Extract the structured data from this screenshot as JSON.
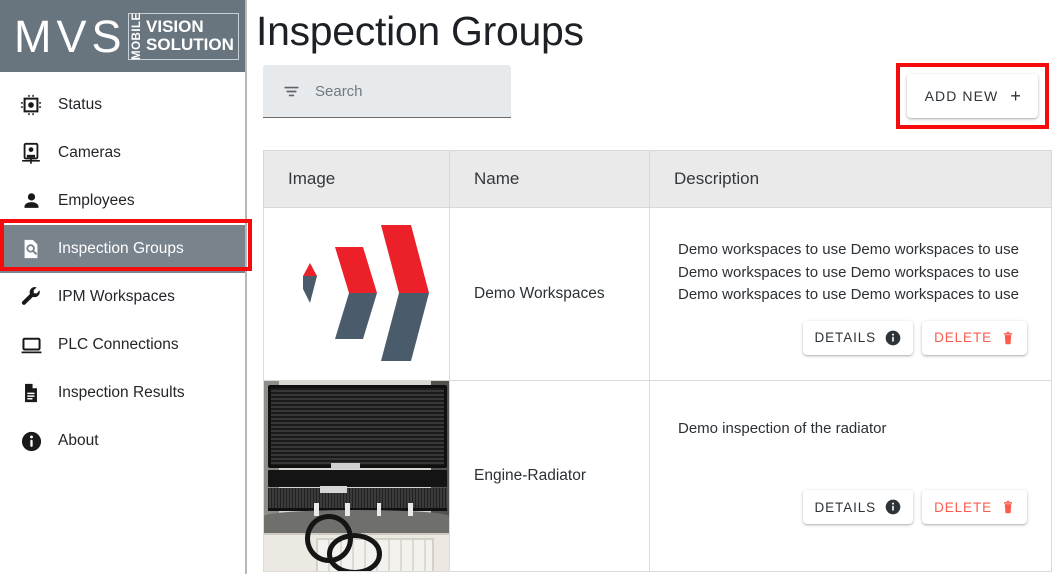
{
  "app": {
    "logo": {
      "main_text": "MVS",
      "vertical_text": "MOBILE",
      "line1": "VISION",
      "line2": "SOLUTION"
    },
    "accent_red": "#f50b0b",
    "sidebar_bg": "#68757f",
    "active_item_bg": "#78838c",
    "delete_color": "#fb5b4d"
  },
  "sidebar": {
    "items": [
      {
        "label": "Status",
        "icon": "chip-icon",
        "active": false
      },
      {
        "label": "Cameras",
        "icon": "camera-icon",
        "active": false
      },
      {
        "label": "Employees",
        "icon": "person-icon",
        "active": false
      },
      {
        "label": "Inspection Groups",
        "icon": "document-search-icon",
        "active": true
      },
      {
        "label": "IPM Workspaces",
        "icon": "wrench-icon",
        "active": false
      },
      {
        "label": "PLC Connections",
        "icon": "laptop-icon",
        "active": false
      },
      {
        "label": "Inspection Results",
        "icon": "file-lines-icon",
        "active": false
      },
      {
        "label": "About",
        "icon": "info-circle-icon",
        "active": false
      }
    ]
  },
  "header": {
    "title": "Inspection Groups"
  },
  "toolbar": {
    "search_placeholder": "Search",
    "search_value": "",
    "search_icon": "filter-icon",
    "add_new_label": "ADD NEW",
    "add_new_plus": "+"
  },
  "table": {
    "columns": [
      "Image",
      "Name",
      "Description"
    ],
    "rows": [
      {
        "image": "mvs-chevron-logo",
        "name": "Demo Workspaces",
        "description": "Demo workspaces to use Demo workspaces to use Demo workspaces to use Demo workspaces to use Demo workspaces to use Demo workspaces to use",
        "details_label": "DETAILS",
        "delete_label": "DELETE"
      },
      {
        "image": "engine-radiator-photo",
        "name": "Engine-Radiator",
        "description": "Demo inspection of the radiator",
        "details_label": "DETAILS",
        "delete_label": "DELETE"
      }
    ]
  }
}
